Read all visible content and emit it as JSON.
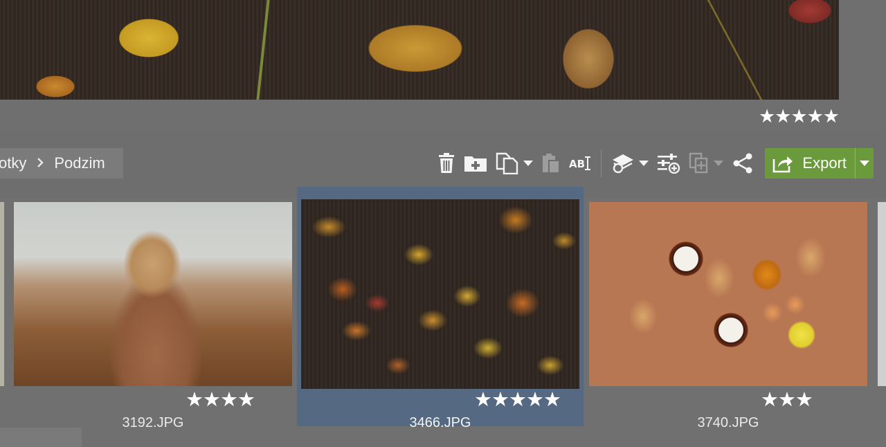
{
  "preview": {
    "rating": "★★★★★"
  },
  "breadcrumb": {
    "items": [
      "otky",
      "Podzim"
    ]
  },
  "toolbar": {
    "export_label": "Export",
    "icons": [
      "trash-icon",
      "new-folder-icon",
      "copy-icon",
      "paste-icon",
      "rename-icon",
      "effects-icon",
      "adjust-icon",
      "batch-icon",
      "share-icon",
      "export-icon"
    ]
  },
  "filmstrip": {
    "items": [
      {
        "filename": "3192.JPG",
        "rating": "★★★★",
        "selected": false
      },
      {
        "filename": "3466.JPG",
        "rating": "★★★★★",
        "selected": true
      },
      {
        "filename": "3740.JPG",
        "rating": "★★★",
        "selected": false
      }
    ]
  },
  "colors": {
    "background": "#6e6e6e",
    "selection": "#566982",
    "export_accent": "#6a9a3c"
  }
}
